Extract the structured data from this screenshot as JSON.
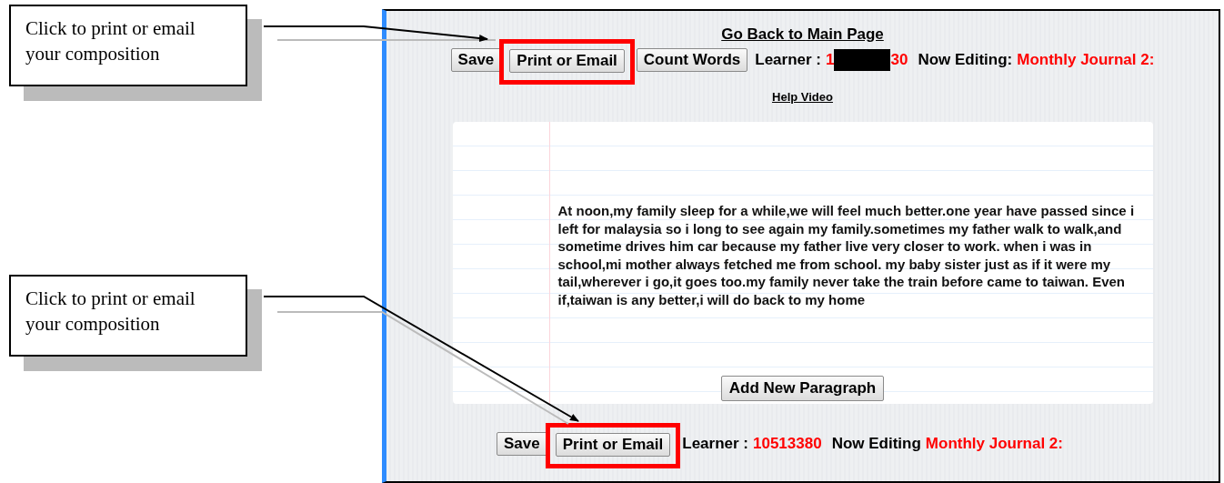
{
  "callouts": [
    {
      "text": "Click to print or email your composition"
    },
    {
      "text": "Click to print or email your composition"
    }
  ],
  "page": {
    "back_link": "Go Back to Main Page",
    "top_bar": {
      "buttons": [
        {
          "label": "Save",
          "highlighted": false
        },
        {
          "label": "Print or Email",
          "highlighted": true
        },
        {
          "label": "Count Words",
          "highlighted": false
        }
      ],
      "learner_label": "Learner :",
      "learner_id_start": "1",
      "learner_id_redacted": true,
      "learner_id_end": "30",
      "editing_label": "Now Editing:",
      "editing_title": "Monthly Journal 2:"
    },
    "help_link": "Help Video",
    "composition": {
      "text": "At noon,my family sleep for a while,we will feel much better.one year have passed since i left for malaysia so i long to see again my family.sometimes my father walk to walk,and sometime drives him car because my father live very closer to work. when i was in school,mi mother always fetched me from school. my baby sister just as if it were my tail,wherever i go,it goes too.my family never take the train before came to taiwan. Even if,taiwan is any better,i will do back to my home",
      "add_button": "Add New Paragraph"
    },
    "bottom_bar": {
      "buttons": [
        {
          "label": "Save",
          "highlighted": false
        },
        {
          "label": "Print or Email",
          "highlighted": true
        }
      ],
      "learner_label": "Learner :",
      "learner_id": "10513380",
      "editing_label": "Now Editing",
      "editing_title": "Monthly Journal 2:"
    }
  }
}
